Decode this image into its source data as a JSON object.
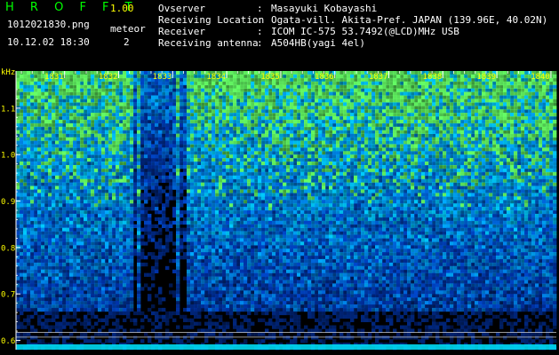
{
  "header": {
    "app_title": "H R O F F T",
    "version": "1.00",
    "filename": "1012021830.png",
    "datetime": "10.12.02 18:30",
    "meteor_label": "meteor",
    "meteor_count": "2",
    "info": [
      {
        "key": "Ovserver",
        "value": "Masayuki Kobayashi"
      },
      {
        "key": "Receiving Location",
        "value": "Ogata-vill. Akita-Pref. JAPAN (139.96E, 40.02N)"
      },
      {
        "key": "Receiver",
        "value": "ICOM IC-575 53.7492(@LCD)MHz USB"
      },
      {
        "key": "Receiving antenna",
        "value": "A504HB(yagi 4el)"
      }
    ],
    "separator": ":"
  },
  "spectrogram": {
    "y_unit": "kHz",
    "y_ticks": [
      "1.1",
      "1.0",
      "0.9",
      "0.8",
      "0.7",
      "0.6"
    ],
    "y_values": [
      1.1,
      1.0,
      0.9,
      0.8,
      0.7,
      0.6
    ],
    "y_range": [
      0.58,
      1.18
    ],
    "x_ticks": [
      "1831",
      "1832",
      "1833",
      "1834",
      "1835",
      "1836",
      "1837",
      "1838",
      "1839",
      "1840"
    ],
    "x_values": [
      1831,
      1832,
      1833,
      1834,
      1835,
      1836,
      1837,
      1838,
      1839,
      1840
    ],
    "x_range": [
      1830.1,
      1840.1
    ],
    "colors": {
      "background": "#000000",
      "tick_text": "#ffff00",
      "axis": "#ffffff",
      "title": "#00ff00",
      "noise_low": "#001a66",
      "noise_high": "#00ccff",
      "noise_peak": "#66ff66"
    }
  }
}
